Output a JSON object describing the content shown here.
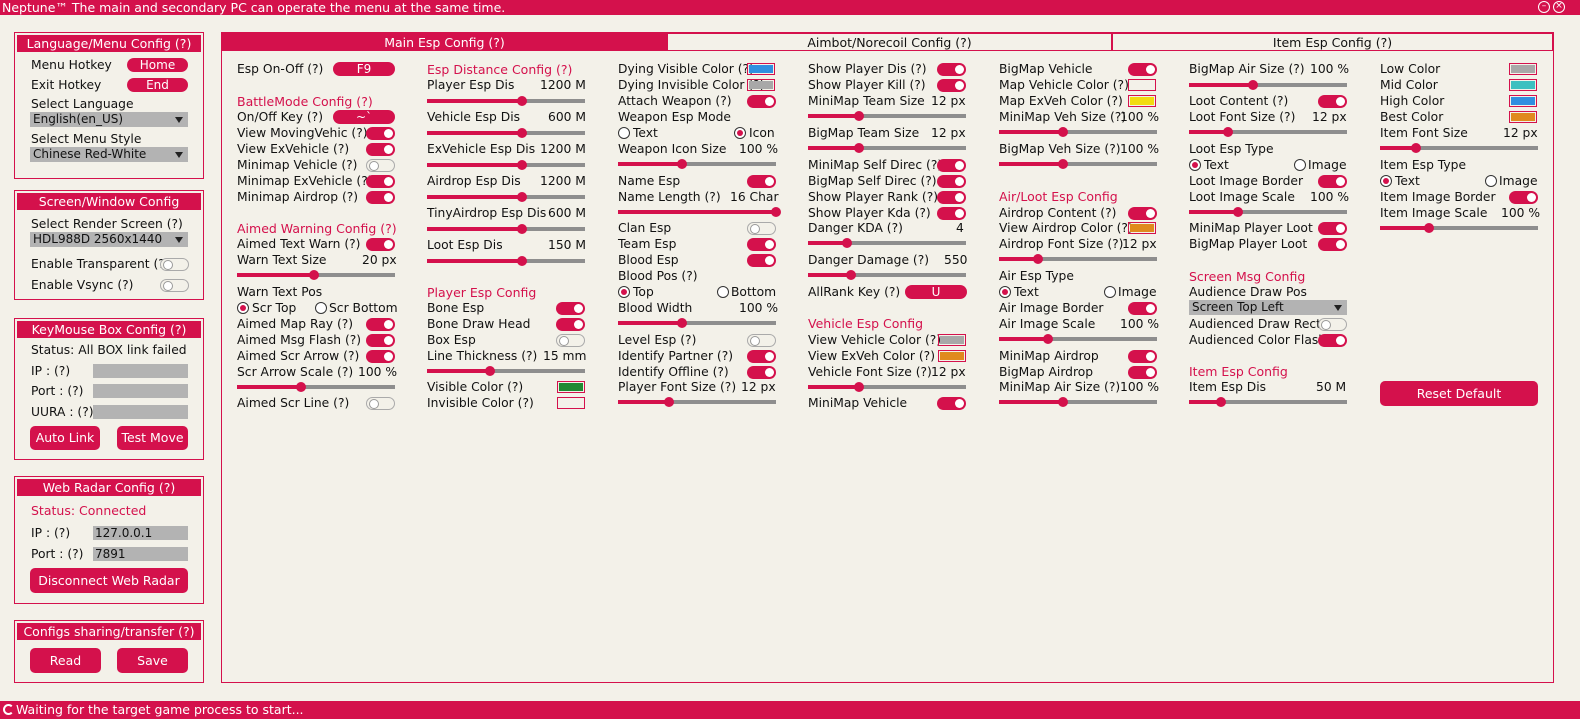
{
  "titlebar": {
    "title": "Neptune™  The main and secondary PC can operate the menu at the same time."
  },
  "statusbar": {
    "text": "Waiting for the target game process to start..."
  },
  "colors": {
    "accent": "#d4114c",
    "background": "#f3f1e9",
    "field": "#b3b3b3"
  },
  "sidebar": {
    "lang": {
      "title": "Language/Menu Config (?)",
      "menu_hotkey_label": "Menu Hotkey",
      "menu_hotkey_value": "Home",
      "exit_hotkey_label": "Exit Hotkey",
      "exit_hotkey_value": "End",
      "select_language_label": "Select Language",
      "language_value": "English(en_US)",
      "select_style_label": "Select Menu Style",
      "style_value": "Chinese Red-White"
    },
    "screen": {
      "title": "Screen/Window Config",
      "render_label": "Select Render Screen (?)",
      "render_value": "HDL988D 2560x1440",
      "transparent_label": "Enable Transparent (?)",
      "vsync_label": "Enable Vsync (?)"
    },
    "keymouse": {
      "title": "KeyMouse Box Config (?)",
      "status": "Status: All BOX link failed",
      "ip_label": "IP : (?)",
      "port_label": "Port : (?)",
      "uura_label": "UURA : (?)",
      "auto_link": "Auto Link",
      "test_move": "Test Move"
    },
    "radar": {
      "title": "Web Radar Config (?)",
      "status": "Status: Connected",
      "ip_label": "IP : (?)",
      "ip_value": "127.0.0.1",
      "port_label": "Port : (?)",
      "port_value": "7891",
      "disconnect": "Disconnect Web Radar"
    },
    "share": {
      "title": "Configs sharing/transfer (?)",
      "read": "Read",
      "save": "Save"
    }
  },
  "tabs": [
    "Main Esp Config (?)",
    "Aimbot/Norecoil Config (?)",
    "Item Esp Config (?)"
  ],
  "col1": {
    "esp_onoff_label": "Esp On-Off (?)",
    "esp_onoff_key": "F9",
    "battle_title": "BattleMode Config (?)",
    "onoff_key_label": "On/Off Key (?)",
    "onoff_key_value": "~`",
    "view_moving": "View MovingVehic (?)",
    "view_exvehicle": "View ExVehicle (?)",
    "minimap_vehicle": "Minimap Vehicle (?)",
    "minimap_exvehicle": "Minimap ExVehicle (?)",
    "minimap_airdrop": "Minimap Airdrop (?)",
    "aimed_title": "Aimed Warning Config (?)",
    "aimed_text_warn": "Aimed Text Warn (?)",
    "warn_text_size": "Warn Text Size",
    "warn_text_size_val": "20 px",
    "warn_text_pos": "Warn Text Pos",
    "scr_top": "Scr Top",
    "scr_bottom": "Scr Bottom",
    "aimed_map_ray": "Aimed Map Ray (?)",
    "aimed_msg_flash": "Aimed Msg Flash (?)",
    "aimed_scr_arrow": "Aimed Scr Arrow (?)",
    "scr_arrow_scale": "Scr Arrow Scale (?)",
    "scr_arrow_scale_val": "100 %",
    "aimed_scr_line": "Aimed Scr Line (?)"
  },
  "col2": {
    "dist_title": "Esp Distance Config (?)",
    "player_dis": "Player Esp Dis",
    "player_dis_val": "1200 M",
    "vehicle_dis": "Vehicle Esp Dis",
    "vehicle_dis_val": "600 M",
    "exvehicle_dis": "ExVehicle Esp Dis",
    "exvehicle_dis_val": "1200 M",
    "airdrop_dis": "Airdrop Esp Dis",
    "airdrop_dis_val": "1200 M",
    "tinyairdrop_dis": "TinyAirdrop Esp Dis",
    "tinyairdrop_dis_val": "600 M",
    "loot_dis": "Loot Esp Dis",
    "loot_dis_val": "150 M",
    "player_title": "Player Esp Config",
    "bone_esp": "Bone Esp",
    "bone_draw_head": "Bone Draw Head",
    "box_esp": "Box Esp",
    "line_thickness": "Line Thickness (?)",
    "line_thickness_val": "15 mm",
    "visible_color": "Visible Color (?)",
    "invisible_color": "Invisible Color (?)"
  },
  "col3": {
    "dying_visible": "Dying Visible Color (?)",
    "dying_invisible": "Dying Invisible Color (?)",
    "attach_weapon": "Attach Weapon (?)",
    "weapon_mode": "Weapon Esp Mode",
    "mode_text": "Text",
    "mode_icon": "Icon",
    "weapon_icon_size": "Weapon Icon Size",
    "weapon_icon_size_val": "100 %",
    "name_esp": "Name Esp",
    "name_length": "Name Length (?)",
    "name_length_val": "16 Char",
    "clan_esp": "Clan Esp",
    "team_esp": "Team Esp",
    "blood_esp": "Blood Esp",
    "blood_pos": "Blood Pos (?)",
    "pos_top": "Top",
    "pos_bottom": "Bottom",
    "blood_width": "Blood Width",
    "blood_width_val": "100 %",
    "level_esp": "Level Esp (?)",
    "identify_partner": "Identify Partner (?)",
    "identify_offline": "Identify Offline (?)",
    "player_font": "Player Font Size (?)",
    "player_font_val": "12 px"
  },
  "col4": {
    "show_player_dis": "Show Player Dis (?)",
    "show_player_kill": "Show Player Kill (?)",
    "minimap_team_size": "MiniMap Team Size",
    "minimap_team_size_val": "12 px",
    "bigmap_team_size": "BigMap Team Size",
    "bigmap_team_size_val": "12 px",
    "minimap_self": "MiniMap Self Direc (?)",
    "bigmap_self": "BigMap Self Direc (?)",
    "show_rank": "Show Player Rank (?)",
    "show_kda": "Show Player Kda (?)",
    "danger_kda": "Danger KDA (?)",
    "danger_kda_val": "4",
    "danger_damage": "Danger Damage (?)",
    "danger_damage_val": "550",
    "allrank_key": "AllRank Key (?)",
    "allrank_key_val": "U",
    "vehicle_title": "Vehicle Esp Config",
    "view_vehicle_color": "View Vehicle Color (?)",
    "view_exveh_color": "View ExVeh Color (?)",
    "vehicle_font": "Vehicle Font Size (?)",
    "vehicle_font_val": "12 px",
    "minimap_vehicle": "MiniMap Vehicle"
  },
  "col5": {
    "bigmap_vehicle": "BigMap Vehicle",
    "map_vehicle_color": "Map Vehicle Color (?)",
    "map_exveh_color": "Map ExVeh Color (?)",
    "minimap_veh_size": "MiniMap Veh Size (?)",
    "minimap_veh_size_val": "100 %",
    "bigmap_veh_size": "BigMap Veh Size (?)",
    "bigmap_veh_size_val": "100 %",
    "airloot_title": "Air/Loot Esp Config",
    "airdrop_content": "Airdrop Content (?)",
    "view_airdrop_color": "View Airdrop Color (?)",
    "airdrop_font": "Airdrop Font Size (?)",
    "airdrop_font_val": "12 px",
    "air_esp_type": "Air Esp Type",
    "type_text": "Text",
    "type_image": "Image",
    "air_image_border": "Air Image Border",
    "air_image_scale": "Air Image Scale",
    "air_image_scale_val": "100 %",
    "minimap_airdrop": "MiniMap Airdrop",
    "bigmap_airdrop": "BigMap Airdrop",
    "minimap_air_size": "MiniMap Air Size (?)",
    "minimap_air_size_val": "100 %"
  },
  "col6": {
    "bigmap_air_size": "BigMap Air Size (?)",
    "bigmap_air_size_val": "100 %",
    "loot_content": "Loot Content (?)",
    "loot_font": "Loot Font Size (?)",
    "loot_font_val": "12 px",
    "loot_esp_type": "Loot Esp Type",
    "type_text": "Text",
    "type_image": "Image",
    "loot_image_border": "Loot Image Border",
    "loot_image_scale": "Loot Image Scale",
    "loot_image_scale_val": "100 %",
    "minimap_player_loot": "MiniMap Player Loot",
    "bigmap_player_loot": "BigMap Player Loot",
    "msg_title": "Screen Msg Config",
    "audience_draw_pos": "Audience Draw Pos",
    "audience_pos_val": "Screen Top Left",
    "audienced_rect": "Audienced Draw Rect",
    "audienced_flash": "Audienced Color Flash",
    "item_title": "Item Esp Config",
    "item_dis": "Item Esp Dis",
    "item_dis_val": "50 M"
  },
  "col7": {
    "low_color": "Low Color",
    "mid_color": "Mid Color",
    "high_color": "High Color",
    "best_color": "Best Color",
    "item_font": "Item Font Size",
    "item_font_val": "12 px",
    "item_esp_type": "Item Esp Type",
    "type_text": "Text",
    "type_image": "Image",
    "item_image_border": "Item Image Border",
    "item_image_scale": "Item Image Scale",
    "item_image_scale_val": "100 %",
    "reset_default": "Reset Default"
  },
  "swatch_colors": {
    "dying_visible": "#2f8fe0",
    "dying_invisible": "#a8a8a8",
    "visible": "#1f8a32",
    "invisible": "#f3f1e9",
    "view_vehicle": "#a8a8a8",
    "view_exveh": "#e08a1e",
    "map_vehicle": "#f3f1e9",
    "map_exveh": "#f2dc10",
    "view_airdrop": "#e08a1e",
    "low": "#a8a8a8",
    "mid": "#3cc0c0",
    "high": "#2f8fe0",
    "best": "#e08a1e"
  }
}
